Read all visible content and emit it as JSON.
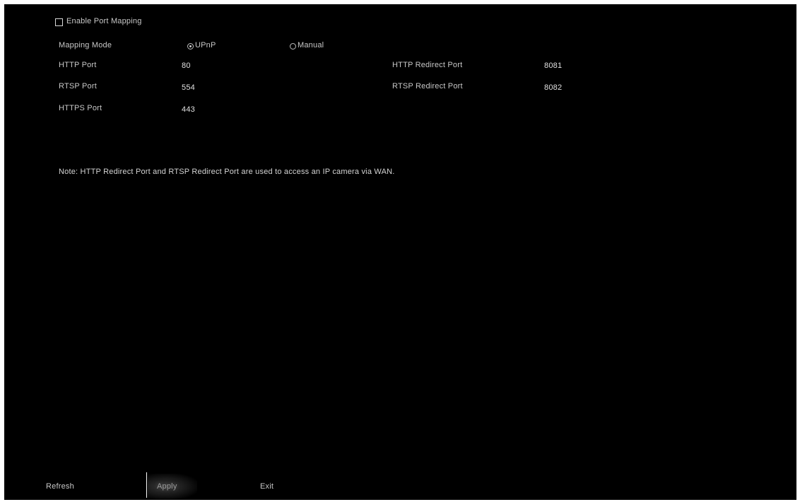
{
  "port_mapping": {
    "enable_label": "Enable Port Mapping",
    "enabled": false,
    "mapping_mode_label": "Mapping Mode",
    "mode_options": [
      "UPnP",
      "Manual"
    ],
    "mode_selected": "UPnP"
  },
  "ports": {
    "http_label": "HTTP Port",
    "http_value": "80",
    "rtsp_label": "RTSP Port",
    "rtsp_value": "554",
    "https_label": "HTTPS Port",
    "https_value": "443",
    "http_redirect_label": "HTTP Redirect Port",
    "http_redirect_value": "8081",
    "rtsp_redirect_label": "RTSP Redirect Port",
    "rtsp_redirect_value": "8082"
  },
  "note": "Note: HTTP Redirect Port and RTSP Redirect Port are used to access an IP camera via WAN.",
  "footer": {
    "refresh_label": "Refresh",
    "apply_label": "Apply",
    "exit_label": "Exit"
  },
  "colors": {
    "background": "#000000",
    "text": "#cfcfcf"
  }
}
